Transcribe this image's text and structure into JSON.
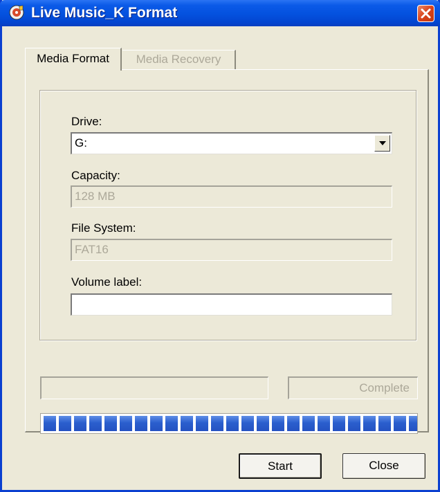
{
  "window": {
    "title": "Live Music_K Format"
  },
  "tabs": [
    {
      "label": "Media Format",
      "active": true
    },
    {
      "label": "Media Recovery",
      "active": false
    }
  ],
  "form": {
    "drive": {
      "label": "Drive:",
      "value": "G:"
    },
    "capacity": {
      "label": "Capacity:",
      "value": "128 MB"
    },
    "file_system": {
      "label": "File System:",
      "value": "FAT16"
    },
    "volume_label": {
      "label": "Volume label:",
      "value": ""
    }
  },
  "status": {
    "left_text": "",
    "right_text": "Complete"
  },
  "progress": {
    "fraction": 1.0,
    "segments": 25,
    "color": "#2b5fce"
  },
  "buttons": {
    "start": "Start",
    "close": "Close"
  },
  "icons": {
    "app": "music-disc-icon",
    "close": "close-icon",
    "dropdown": "chevron-down-icon"
  },
  "colors": {
    "titlebar": "#0451de",
    "close_button": "#d9421a",
    "window_bg": "#ece9d8"
  }
}
